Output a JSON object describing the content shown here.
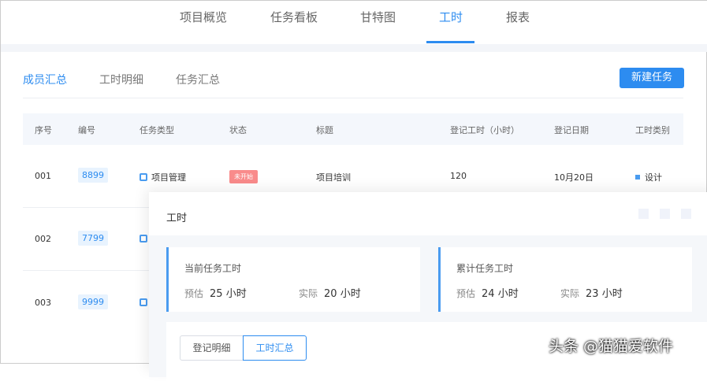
{
  "top_tabs": [
    "项目概览",
    "任务看板",
    "甘特图",
    "工时",
    "报表"
  ],
  "sub_tabs": [
    "成员汇总",
    "工时明细",
    "任务汇总"
  ],
  "new_task_label": "新建任务",
  "columns": [
    "序号",
    "编号",
    "任务类型",
    "状态",
    "标题",
    "登记工时（小时）",
    "登记日期",
    "工时类别"
  ],
  "rows": [
    {
      "index": "001",
      "code": "8899",
      "type": "项目管理",
      "status": "未开始",
      "title": "项目培训",
      "hours": "120",
      "date": "10月20日",
      "category": "设计"
    },
    {
      "index": "002",
      "code": "7799"
    },
    {
      "index": "003",
      "code": "9999"
    }
  ],
  "panel": {
    "title": "工时",
    "cards": [
      {
        "title": "当前任务工时",
        "est_label": "预估",
        "est": "25 小时",
        "act_label": "实际",
        "act": "20 小时"
      },
      {
        "title": "累计任务工时",
        "est_label": "预估",
        "est": "24 小时",
        "act_label": "实际",
        "act": "23 小时"
      }
    ],
    "segments": [
      "登记明细",
      "工时汇总"
    ]
  },
  "watermark": "头条 @猫猫爱软件",
  "colors": {
    "accent": "#2d8cf0",
    "status_not_started": "#f98b8b"
  }
}
